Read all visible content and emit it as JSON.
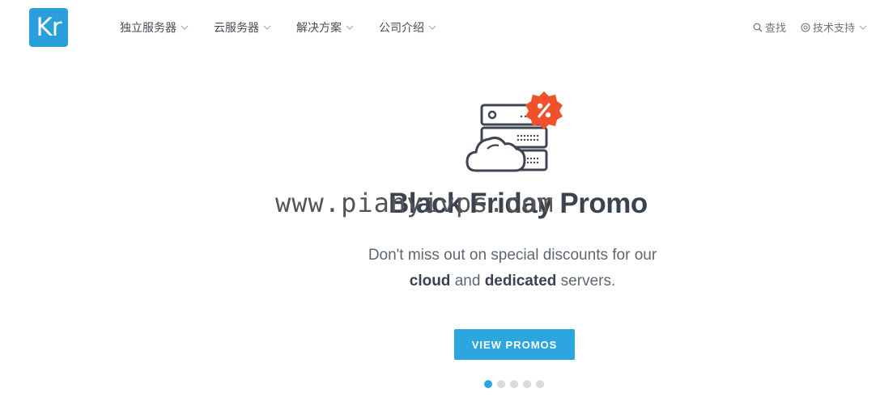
{
  "brand": {
    "logo_text": "Kr",
    "color": "#2a9fdc"
  },
  "nav": {
    "items": [
      {
        "label": "独立服务器"
      },
      {
        "label": "云服务器"
      },
      {
        "label": "解决方案"
      },
      {
        "label": "公司介绍"
      }
    ],
    "search_label": "查找",
    "support_label": "技术支持"
  },
  "hero": {
    "icon": "server-cloud-discount-icon",
    "watermark": "www.pianyivps.com",
    "title": "Black Friday Promo",
    "subtitle_line1": "Don't miss out on special discounts for our",
    "subtitle_bold1": "cloud",
    "subtitle_mid": " and ",
    "subtitle_bold2": "dedicated",
    "subtitle_end": " servers.",
    "cta_label": "VIEW PROMOS",
    "accent_color": "#2ca6df",
    "badge_color": "#f0512b"
  },
  "carousel": {
    "slides": 5,
    "active_index": 1
  }
}
